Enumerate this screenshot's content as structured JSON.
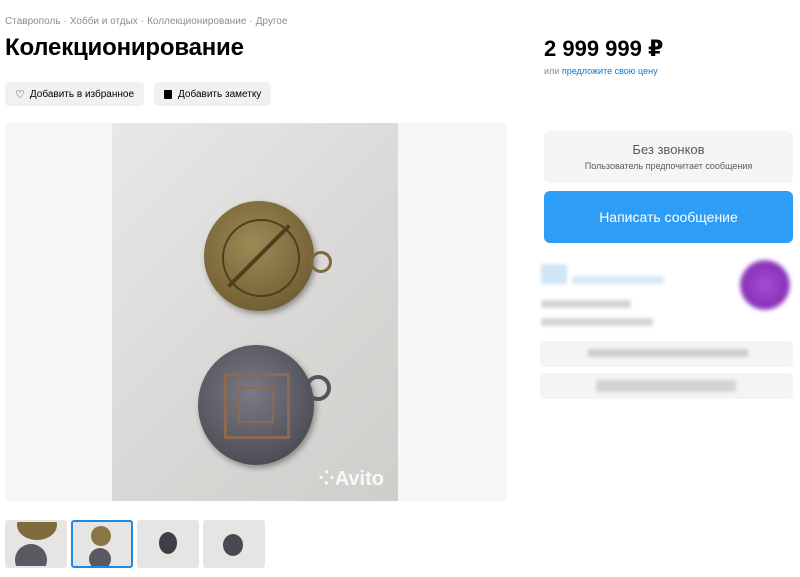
{
  "breadcrumb": [
    "Ставрополь",
    "Хобби и отдых",
    "Коллекционирование",
    "Другое"
  ],
  "breadcrumb_separator": "·",
  "title": "Колекционирование",
  "actions": {
    "favorite_label": "Добавить в избранное",
    "note_label": "Добавить заметку"
  },
  "gallery": {
    "watermark": "Avito",
    "thumbnail_count": 4,
    "active_thumbnail": 1
  },
  "price": {
    "value": "2 999 999 ₽",
    "offer_prefix": "или",
    "offer_link": "предложите свою цену"
  },
  "contact": {
    "no_calls_title": "Без звонков",
    "no_calls_sub": "Пользователь предпочитает сообщения",
    "write_button": "Написать сообщение"
  },
  "colors": {
    "accent": "#2e9df5",
    "link": "#0a7bd6",
    "active_thumb_border": "#1e88e5"
  }
}
